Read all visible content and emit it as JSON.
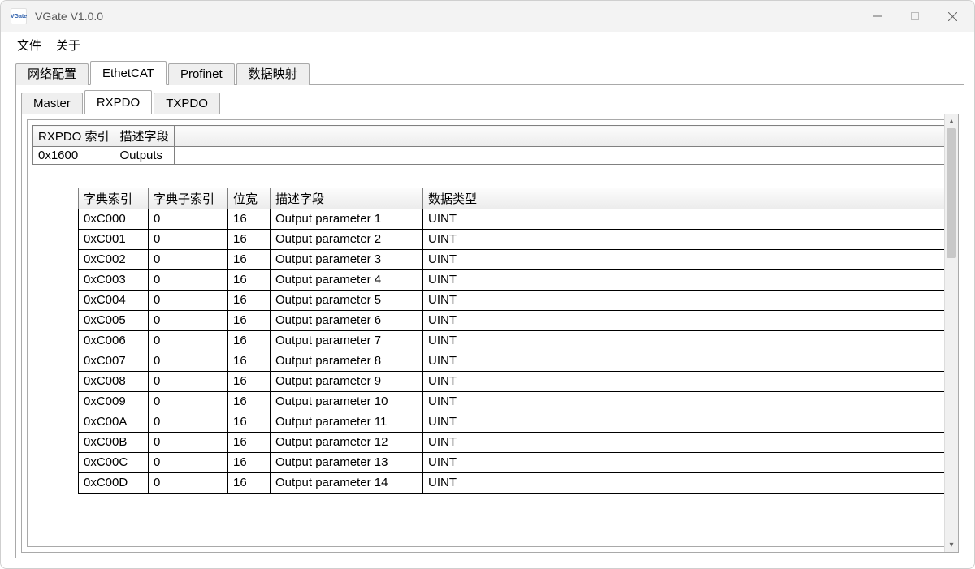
{
  "window": {
    "title": "VGate V1.0.0",
    "icon_text": "VGate"
  },
  "menu": {
    "file": "文件",
    "about": "关于"
  },
  "tabs_outer": {
    "net_cfg": "网络配置",
    "ethercat": "EthetCAT",
    "profinet": "Profinet",
    "data_map": "数据映射"
  },
  "tabs_inner": {
    "master": "Master",
    "rxpdo": "RXPDO",
    "txpdo": "TXPDO"
  },
  "index_table": {
    "headers": {
      "idx": "RXPDO 索引",
      "desc": "描述字段"
    },
    "row": {
      "idx": "0x1600",
      "desc": "Outputs"
    }
  },
  "param_table": {
    "headers": {
      "dict_idx": "字典索引",
      "dict_sub": "字典子索引",
      "bits": "位宽",
      "desc": "描述字段",
      "dtype": "数据类型"
    },
    "rows": [
      {
        "idx": "0xC000",
        "sub": "0",
        "bits": "16",
        "desc": "Output parameter 1",
        "dtype": "UINT"
      },
      {
        "idx": "0xC001",
        "sub": "0",
        "bits": "16",
        "desc": "Output parameter 2",
        "dtype": "UINT"
      },
      {
        "idx": "0xC002",
        "sub": "0",
        "bits": "16",
        "desc": "Output parameter 3",
        "dtype": "UINT"
      },
      {
        "idx": "0xC003",
        "sub": "0",
        "bits": "16",
        "desc": "Output parameter 4",
        "dtype": "UINT"
      },
      {
        "idx": "0xC004",
        "sub": "0",
        "bits": "16",
        "desc": "Output parameter 5",
        "dtype": "UINT"
      },
      {
        "idx": "0xC005",
        "sub": "0",
        "bits": "16",
        "desc": "Output parameter 6",
        "dtype": "UINT"
      },
      {
        "idx": "0xC006",
        "sub": "0",
        "bits": "16",
        "desc": "Output parameter 7",
        "dtype": "UINT"
      },
      {
        "idx": "0xC007",
        "sub": "0",
        "bits": "16",
        "desc": "Output parameter 8",
        "dtype": "UINT"
      },
      {
        "idx": "0xC008",
        "sub": "0",
        "bits": "16",
        "desc": "Output parameter 9",
        "dtype": "UINT"
      },
      {
        "idx": "0xC009",
        "sub": "0",
        "bits": "16",
        "desc": "Output parameter 10",
        "dtype": "UINT"
      },
      {
        "idx": "0xC00A",
        "sub": "0",
        "bits": "16",
        "desc": "Output parameter 11",
        "dtype": "UINT"
      },
      {
        "idx": "0xC00B",
        "sub": "0",
        "bits": "16",
        "desc": "Output parameter 12",
        "dtype": "UINT"
      },
      {
        "idx": "0xC00C",
        "sub": "0",
        "bits": "16",
        "desc": "Output parameter 13",
        "dtype": "UINT"
      },
      {
        "idx": "0xC00D",
        "sub": "0",
        "bits": "16",
        "desc": "Output parameter 14",
        "dtype": "UINT"
      }
    ]
  }
}
